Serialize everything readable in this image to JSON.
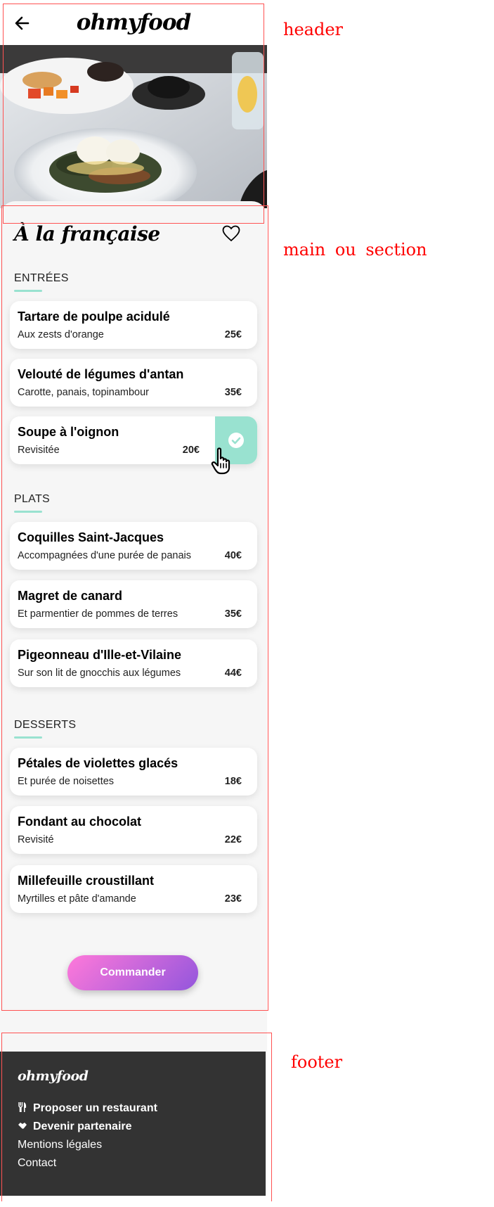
{
  "app": {
    "logo": "ohmyfood"
  },
  "restaurant": {
    "title": "À la française"
  },
  "sections": [
    {
      "title": "ENTRÉES",
      "dishes": [
        {
          "name": "Tartare de poulpe acidulé",
          "description": "Aux zests d'orange",
          "price": "25€"
        },
        {
          "name": "Velouté de légumes d'antan",
          "description": "Carotte, panais, topinambour",
          "price": "35€"
        },
        {
          "name": "Soupe à l'oignon",
          "description": "Revisitée",
          "price": "20€",
          "selected": true
        }
      ]
    },
    {
      "title": "PLATS",
      "dishes": [
        {
          "name": "Coquilles Saint-Jacques",
          "description": "Accompagnées d'une purée de panais",
          "price": "40€"
        },
        {
          "name": "Magret de canard",
          "description": "Et parmentier de pommes de terres",
          "price": "35€"
        },
        {
          "name": "Pigeonneau d'Ille-et-Vilaine",
          "description": "Sur son lit de gnocchis aux légumes",
          "price": "44€"
        }
      ]
    },
    {
      "title": "DESSERTS",
      "dishes": [
        {
          "name": "Pétales de violettes glacés",
          "description": "Et purée de noisettes",
          "price": "18€"
        },
        {
          "name": "Fondant au chocolat",
          "description": "Revisité",
          "price": "22€"
        },
        {
          "name": "Millefeuille croustillant",
          "description": "Myrtilles et pâte d'amande",
          "price": "23€"
        }
      ]
    }
  ],
  "order_button": "Commander",
  "footer": {
    "logo": "ohmyfood",
    "links": [
      {
        "label": "Proposer un restaurant",
        "icon": "utensils-icon"
      },
      {
        "label": "Devenir partenaire",
        "icon": "handshake-icon"
      },
      {
        "label": "Mentions légales"
      },
      {
        "label": "Contact"
      }
    ]
  },
  "annotations": {
    "header": "header",
    "main": "main ou section",
    "footer": "footer"
  },
  "colors": {
    "accent": "#99e2d0",
    "footer_bg": "#333333",
    "gradient_start": "#ff79da",
    "gradient_end": "#9356dc",
    "annotation": "#ff0000"
  }
}
